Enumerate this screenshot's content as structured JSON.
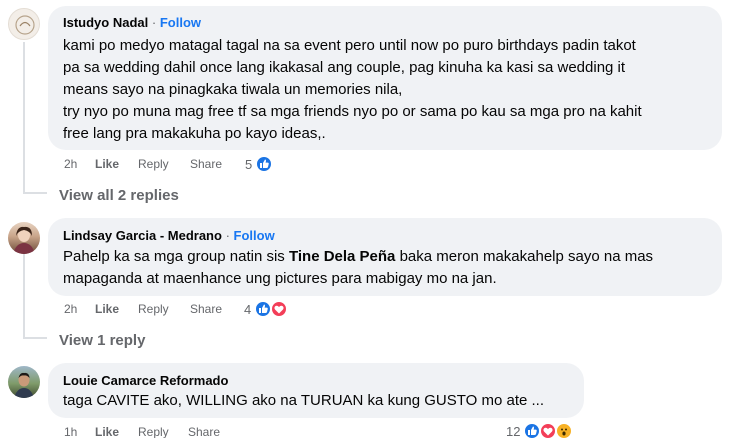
{
  "comments": [
    {
      "author": "Istudyo Nadal",
      "follow": "Follow",
      "separator": "·",
      "lines": [
        "kami po medyo matagal tagal na sa event pero until now po puro birthdays padin takot",
        "pa sa wedding dahil once lang ikakasal ang couple, pag kinuha ka kasi sa wedding it",
        "means sayo na pinagkaka tiwala un memories nila,",
        "try nyo po muna mag free tf sa mga friends nyo po or sama po kau sa mga pro na kahit",
        "free lang pra makakuha po kayo ideas,."
      ],
      "time": "2h",
      "like": "Like",
      "reply": "Reply",
      "share": "Share",
      "reaction_count": "5",
      "reactions": [
        "like-icon"
      ],
      "view_replies": "View all 2 replies"
    },
    {
      "author": "Lindsay Garcia - Medrano",
      "follow": "Follow",
      "separator": "·",
      "line1_pre": "Pahelp ka sa mga group natin sis ",
      "line1_tag": "Tine Dela Peña",
      "line1_post": " baka meron makakahelp sayo na mas",
      "line2": "mapaganda at maenhance ung pictures para mabigay mo na jan.",
      "time": "2h",
      "like": "Like",
      "reply": "Reply",
      "share": "Share",
      "reaction_count": "4",
      "reactions": [
        "like-icon",
        "love-icon"
      ],
      "view_replies": "View 1 reply"
    },
    {
      "author": "Louie Camarce Reformado",
      "line1": "taga CAVITE ako, WILLING ako na TURUAN ka kung GUSTO mo ate ...",
      "time": "1h",
      "like": "Like",
      "reply": "Reply",
      "share": "Share",
      "reaction_count": "12",
      "reactions": [
        "like-icon",
        "love-icon",
        "care-icon"
      ]
    }
  ],
  "colors": {
    "bubble": "#f0f2f5",
    "link": "#1877f2",
    "meta": "#65676b",
    "like": "#1b74e4",
    "love": "#f33e58",
    "care": "#f7b125"
  }
}
